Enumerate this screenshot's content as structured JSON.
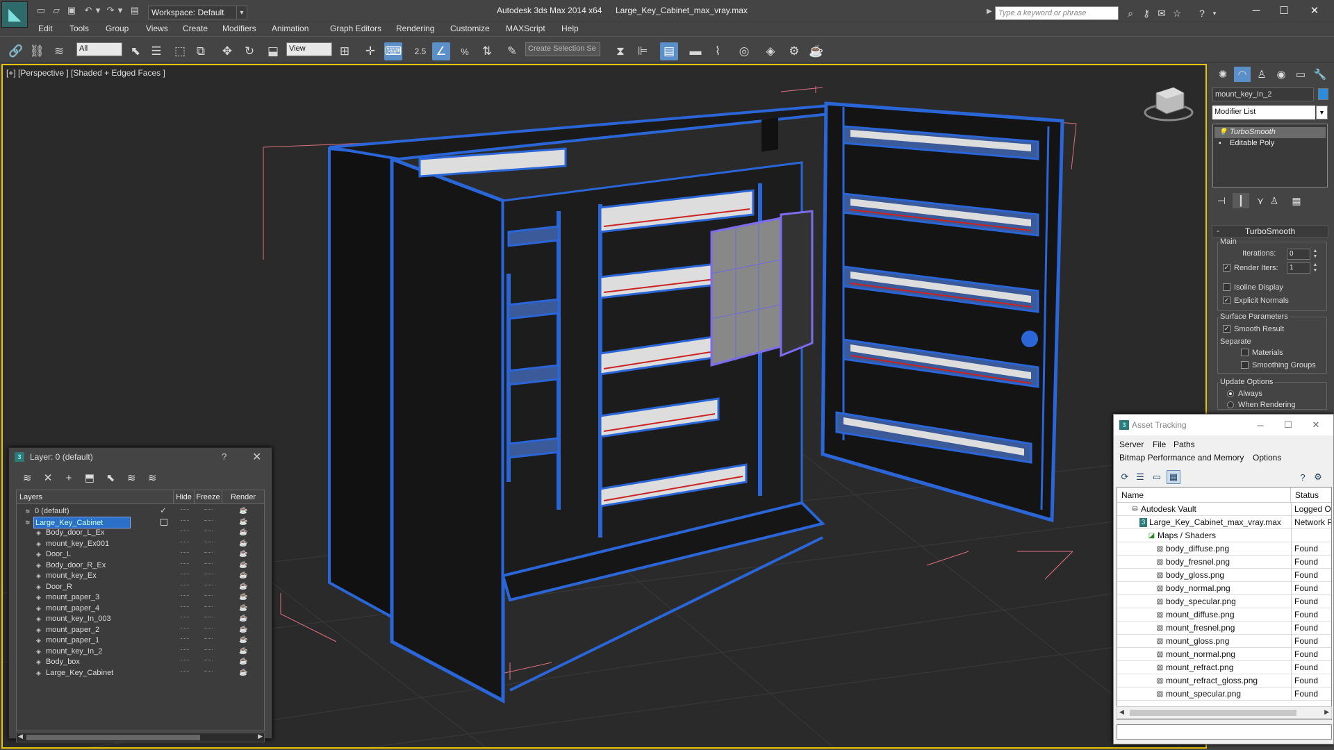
{
  "app": {
    "title": "Autodesk 3ds Max  2014 x64",
    "file": "Large_Key_Cabinet_max_vray.max",
    "logo": "3ds Max"
  },
  "workspace": {
    "label": "Workspace: Default"
  },
  "search": {
    "placeholder": "Type a keyword or phrase"
  },
  "menu": [
    "Edit",
    "Tools",
    "Group",
    "Views",
    "Create",
    "Modifiers",
    "Animation",
    "Graph Editors",
    "Rendering",
    "Customize",
    "MAXScript",
    "Help"
  ],
  "toolbar": {
    "filter": "All",
    "coord_system": "View",
    "snap_label": "2.5",
    "selection_set_placeholder": "Create Selection Se"
  },
  "viewport": {
    "label": "[+] [Perspective ] [Shaded + Edged Faces ]",
    "border_color": "#e8c300"
  },
  "command_panel": {
    "object_name": "mount_key_In_2",
    "object_color": "#2c8ce0",
    "modifier_list": "Modifier List",
    "stack": [
      "TurboSmooth",
      "Editable Poly"
    ],
    "rollout_title": "TurboSmooth",
    "main_group": "Main",
    "iterations_label": "Iterations:",
    "iterations_value": "0",
    "render_iters_label": "Render Iters:",
    "render_iters_value": "1",
    "render_iters_checked": true,
    "isoline_label": "Isoline Display",
    "isoline_checked": false,
    "explicit_normals_label": "Explicit Normals",
    "explicit_normals_checked": true,
    "surface_params": "Surface Parameters",
    "smooth_result_label": "Smooth Result",
    "smooth_result_checked": true,
    "separate_label": "Separate",
    "materials_label": "Materials",
    "smoothing_groups_label": "Smoothing Groups",
    "update_options": "Update Options",
    "always_label": "Always",
    "when_rendering_label": "When Rendering"
  },
  "layer_dialog": {
    "title": "Layer: 0 (default)",
    "help": "?",
    "columns": {
      "layers": "Layers",
      "hide": "Hide",
      "freeze": "Freeze",
      "render": "Render"
    },
    "rows": [
      {
        "name": "0 (default)",
        "level": 0,
        "kind": "layer",
        "current": true
      },
      {
        "name": "Large_Key_Cabinet",
        "level": 0,
        "kind": "layer",
        "selected": true
      },
      {
        "name": "Body_door_L_Ex",
        "level": 1,
        "kind": "object"
      },
      {
        "name": "mount_key_Ex001",
        "level": 1,
        "kind": "object"
      },
      {
        "name": "Door_L",
        "level": 1,
        "kind": "object"
      },
      {
        "name": "Body_door_R_Ex",
        "level": 1,
        "kind": "object"
      },
      {
        "name": "mount_key_Ex",
        "level": 1,
        "kind": "object"
      },
      {
        "name": "Door_R",
        "level": 1,
        "kind": "object"
      },
      {
        "name": "mount_paper_3",
        "level": 1,
        "kind": "object"
      },
      {
        "name": "mount_paper_4",
        "level": 1,
        "kind": "object"
      },
      {
        "name": "mount_key_In_003",
        "level": 1,
        "kind": "object"
      },
      {
        "name": "mount_paper_2",
        "level": 1,
        "kind": "object"
      },
      {
        "name": "mount_paper_1",
        "level": 1,
        "kind": "object"
      },
      {
        "name": "mount_key_In_2",
        "level": 1,
        "kind": "object"
      },
      {
        "name": "Body_box",
        "level": 1,
        "kind": "object"
      },
      {
        "name": "Large_Key_Cabinet",
        "level": 1,
        "kind": "object"
      }
    ]
  },
  "asset_dialog": {
    "title": "Asset Tracking",
    "menu1": [
      "Server",
      "File",
      "Paths"
    ],
    "menu2": [
      "Bitmap Performance and Memory",
      "Options"
    ],
    "columns": {
      "name": "Name",
      "status": "Status"
    },
    "rows": [
      {
        "name": "Autodesk Vault",
        "status": "Logged Out",
        "level": 1,
        "icon": "vault-icon"
      },
      {
        "name": "Large_Key_Cabinet_max_vray.max",
        "status": "Network Path",
        "level": 2,
        "icon": "max-file-icon"
      },
      {
        "name": "Maps / Shaders",
        "status": "",
        "level": 3,
        "icon": "maps-folder-icon"
      },
      {
        "name": "body_diffuse.png",
        "status": "Found",
        "level": 4,
        "icon": "image-file-icon"
      },
      {
        "name": "body_fresnel.png",
        "status": "Found",
        "level": 4,
        "icon": "image-file-icon"
      },
      {
        "name": "body_gloss.png",
        "status": "Found",
        "level": 4,
        "icon": "image-file-icon"
      },
      {
        "name": "body_normal.png",
        "status": "Found",
        "level": 4,
        "icon": "image-file-icon"
      },
      {
        "name": "body_specular.png",
        "status": "Found",
        "level": 4,
        "icon": "image-file-icon"
      },
      {
        "name": "mount_diffuse.png",
        "status": "Found",
        "level": 4,
        "icon": "image-file-icon"
      },
      {
        "name": "mount_fresnel.png",
        "status": "Found",
        "level": 4,
        "icon": "image-file-icon"
      },
      {
        "name": "mount_gloss.png",
        "status": "Found",
        "level": 4,
        "icon": "image-file-icon"
      },
      {
        "name": "mount_normal.png",
        "status": "Found",
        "level": 4,
        "icon": "image-file-icon"
      },
      {
        "name": "mount_refract.png",
        "status": "Found",
        "level": 4,
        "icon": "image-file-icon"
      },
      {
        "name": "mount_refract_gloss.png",
        "status": "Found",
        "level": 4,
        "icon": "image-file-icon"
      },
      {
        "name": "mount_specular.png",
        "status": "Found",
        "level": 4,
        "icon": "image-file-icon"
      }
    ]
  }
}
